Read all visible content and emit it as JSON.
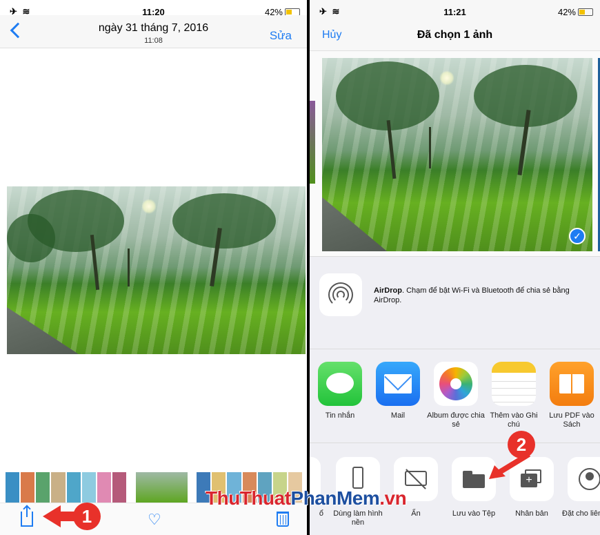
{
  "left": {
    "status": {
      "icons": "✈ ≋",
      "time": "11:20",
      "battery": "42%"
    },
    "nav": {
      "date": "ngày 31 tháng 7, 2016",
      "time": "11:08",
      "edit": "Sửa"
    },
    "step_badge": "1"
  },
  "right": {
    "status": {
      "icons": "✈ ≋",
      "time": "11:21",
      "battery": "42%"
    },
    "nav": {
      "cancel": "Hủy",
      "title": "Đã chọn 1 ảnh"
    },
    "airdrop": {
      "name": "AirDrop",
      "text": ". Chạm để bật Wi-Fi và Bluetooth để chia sẻ bằng AirDrop."
    },
    "apps": [
      {
        "label": "Tin nhắn",
        "icon": "messages-icon"
      },
      {
        "label": "Mail",
        "icon": "mail-icon"
      },
      {
        "label": "Album được chia sẻ",
        "icon": "photos-icon"
      },
      {
        "label": "Thêm vào Ghi chú",
        "icon": "notes-icon"
      },
      {
        "label": "Lưu PDF vào Sách",
        "icon": "books-icon"
      }
    ],
    "actions": [
      {
        "label": "ổ",
        "icon": "partial-icon"
      },
      {
        "label": "Dùng làm hình nền",
        "icon": "wallpaper-icon"
      },
      {
        "label": "Ẩn",
        "icon": "hide-icon"
      },
      {
        "label": "Lưu vào Tệp",
        "icon": "folder-icon"
      },
      {
        "label": "Nhân bản",
        "icon": "duplicate-icon"
      },
      {
        "label": "Đặt cho liên hệ",
        "icon": "contact-icon"
      }
    ],
    "step_badge": "2"
  },
  "watermark": {
    "part1": "ThuThuat",
    "part2": "PhanMem",
    "part3": ".vn"
  },
  "colors": {
    "accent": "#1e7cf2",
    "annotation": "#e8312a"
  }
}
